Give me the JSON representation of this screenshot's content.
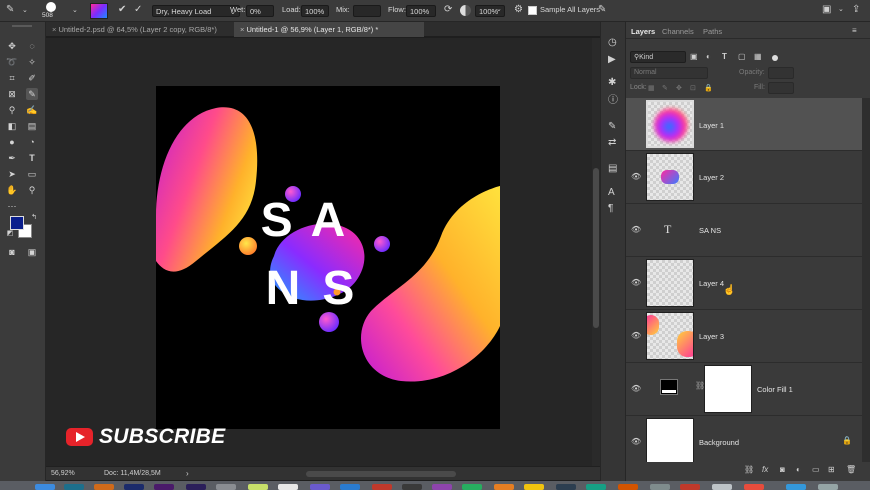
{
  "options_bar": {
    "brush_size": "508",
    "preset": "Dry, Heavy Load",
    "wet_label": "Wet:",
    "wet_value": "0%",
    "load_label": "Load:",
    "load_value": "100%",
    "mix_label": "Mix:",
    "flow_label": "Flow:",
    "flow_value": "100%",
    "opacity_value": "100%",
    "sample_all_layers": "Sample All Layers"
  },
  "doc_tabs": [
    {
      "label": "Untitled-2.psd @ 64,5% (Layer 2 copy, RGB/8*)"
    },
    {
      "label": "Untitled-1 @ 56,9% (Layer 1, RGB/8*) *"
    }
  ],
  "status": {
    "zoom": "56,92%",
    "doc_info": "Doc: 11,4M/28,5M",
    "arrow": "›"
  },
  "artwork": {
    "line1": "SA",
    "line2": "NS"
  },
  "subscribe": {
    "label": "SUBSCRIBE"
  },
  "panel": {
    "tabs": [
      "Layers",
      "Channels",
      "Paths"
    ],
    "filter_label": "Kind",
    "blend_mode": "Normal",
    "opacity_label": "Opacity:",
    "lock_label": "Lock:",
    "fill_label": "Fill:",
    "layers": [
      {
        "name": "Layer 1"
      },
      {
        "name": "Layer 2"
      },
      {
        "name": "SA NS"
      },
      {
        "name": "Layer 4"
      },
      {
        "name": "Layer 3"
      },
      {
        "name": "Color Fill 1"
      },
      {
        "name": "Background"
      }
    ]
  },
  "colors": {
    "foreground": "#0a1e8c",
    "background": "#ffffff",
    "accent_pink": "#e0249a",
    "accent_yellow": "#ffd23a"
  }
}
